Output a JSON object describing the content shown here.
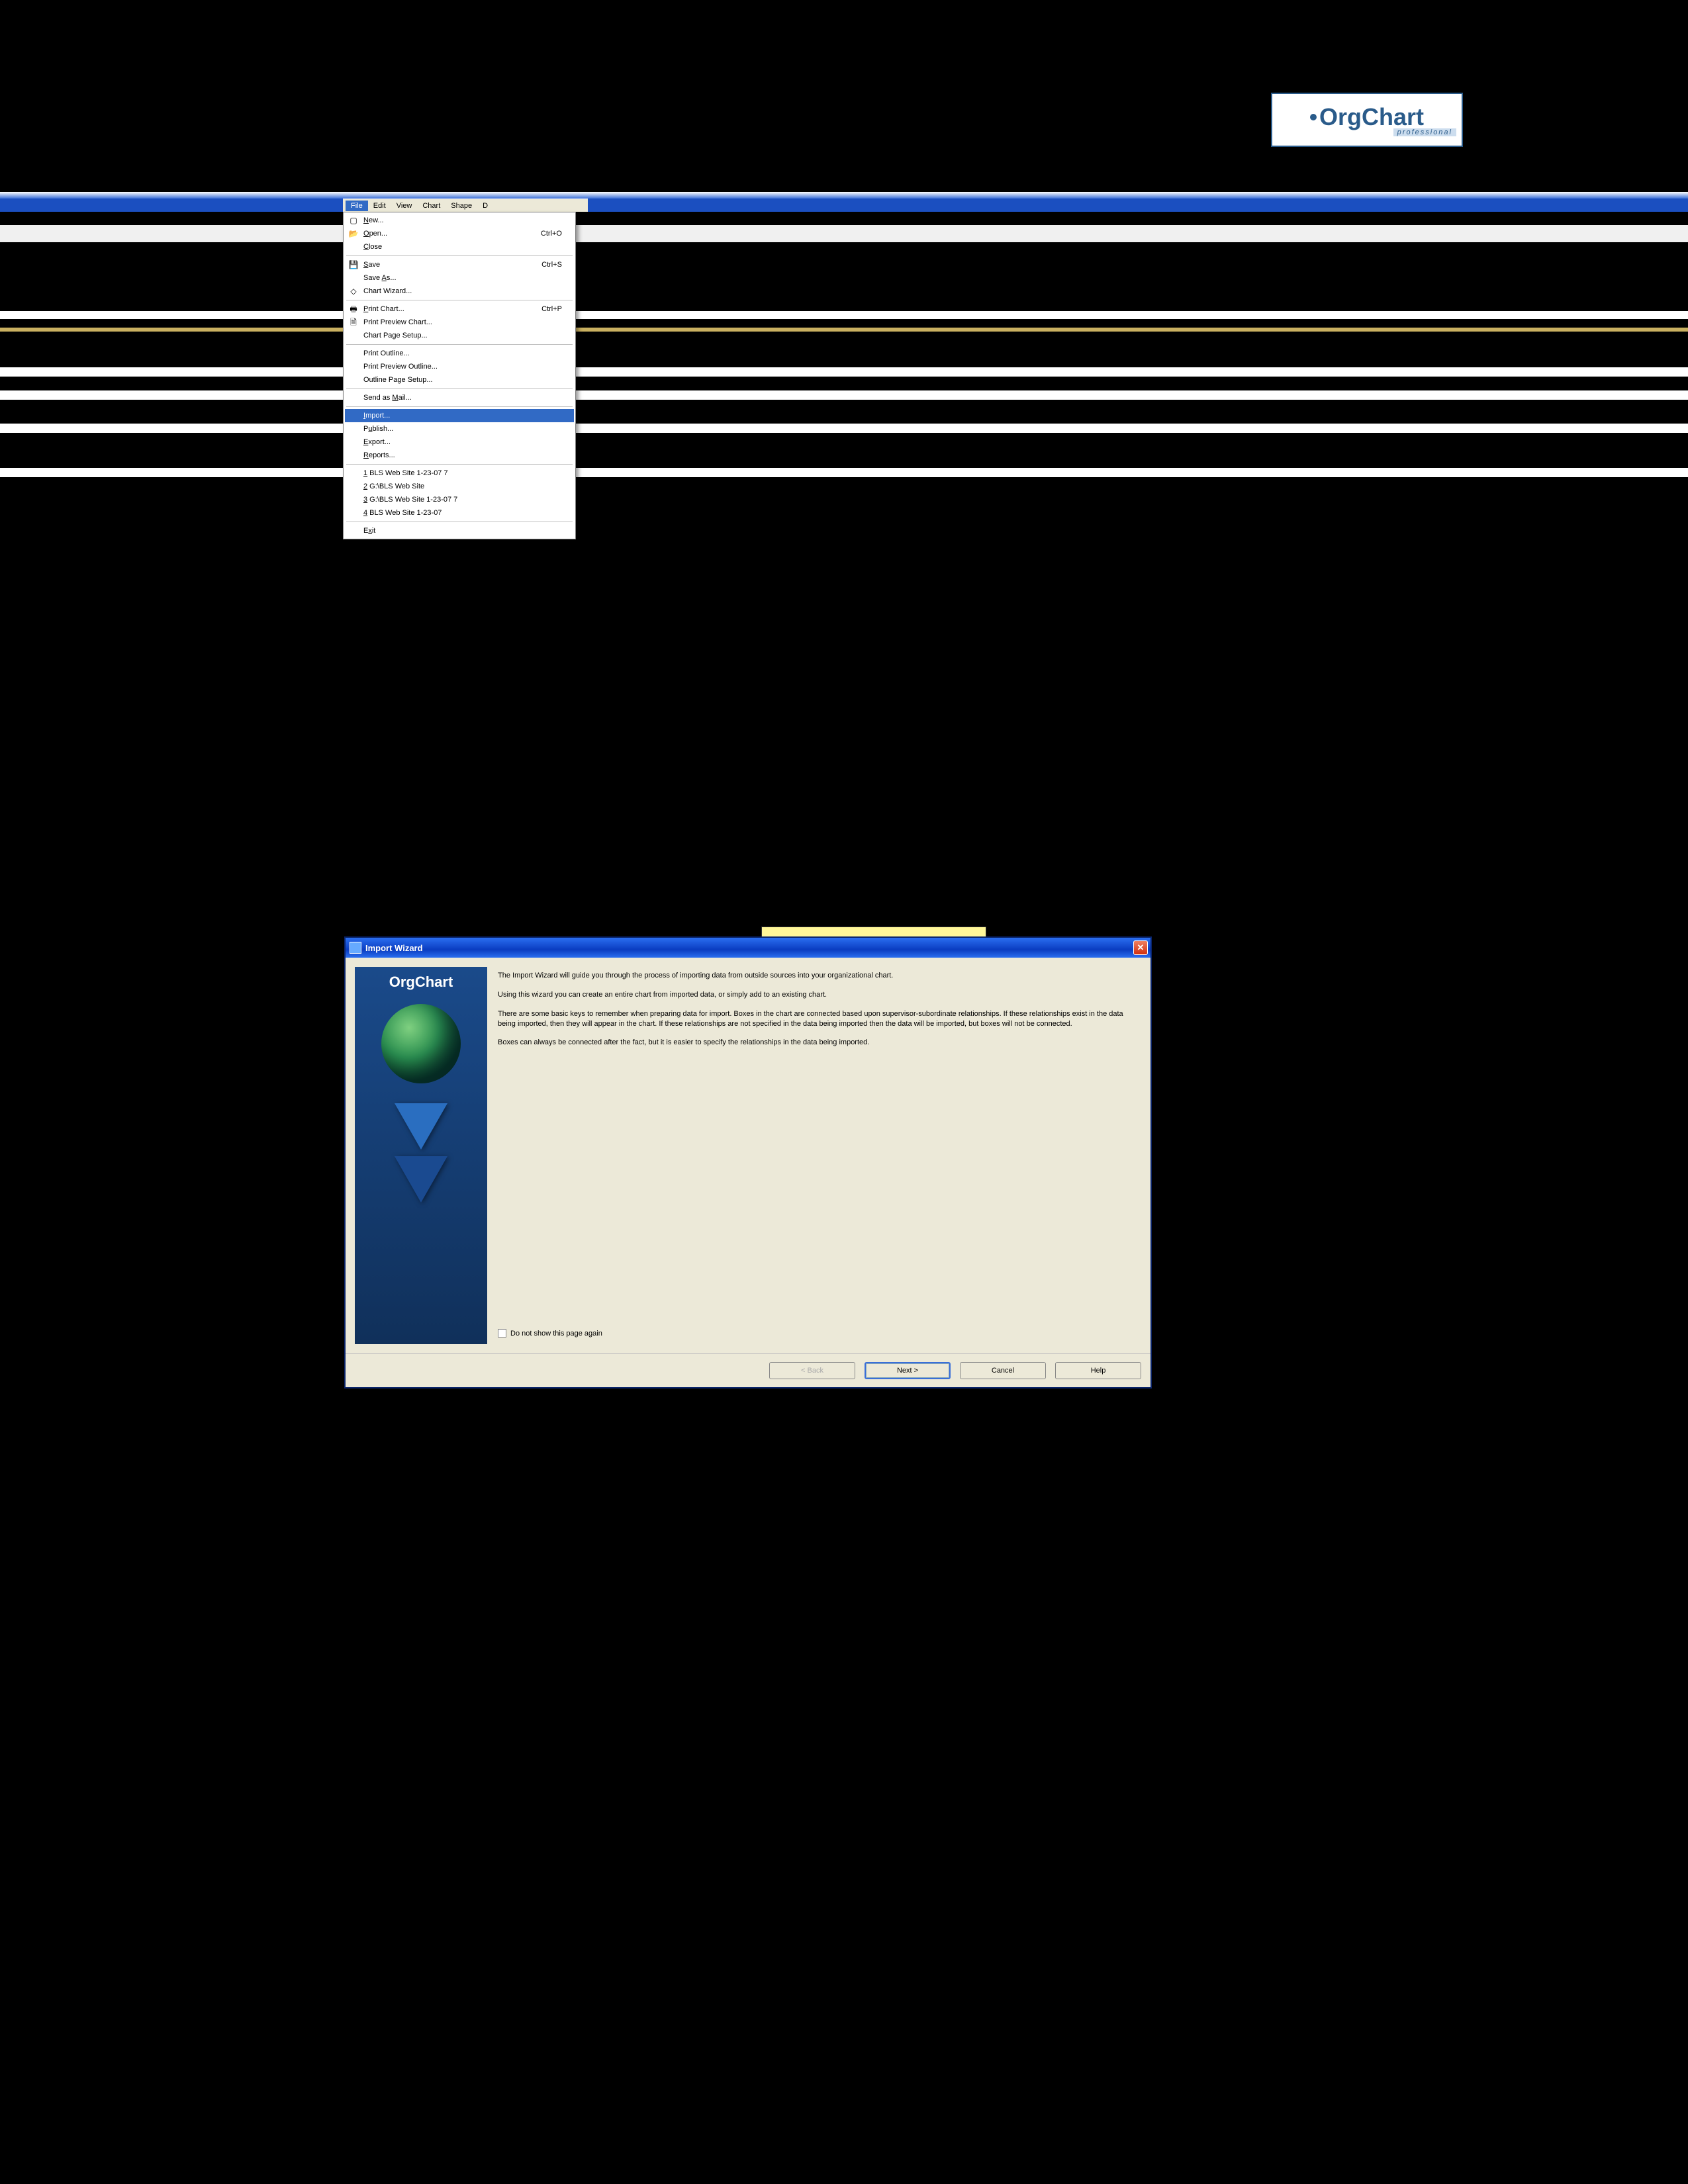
{
  "logo": {
    "text": "OrgChart",
    "subtitle": "professional"
  },
  "menubar": {
    "items": [
      "File",
      "Edit",
      "View",
      "Chart",
      "Shape",
      "D"
    ],
    "active_index": 0
  },
  "file_menu": {
    "groups": [
      [
        {
          "icon": "new-icon",
          "label": "New...",
          "underline": "N",
          "shortcut": ""
        },
        {
          "icon": "open-icon",
          "label": "Open...",
          "underline": "O",
          "shortcut": "Ctrl+O"
        },
        {
          "icon": "",
          "label": "Close",
          "underline": "C",
          "shortcut": ""
        }
      ],
      [
        {
          "icon": "save-icon",
          "label": "Save",
          "underline": "S",
          "shortcut": "Ctrl+S"
        },
        {
          "icon": "",
          "label": "Save As...",
          "underline": "A",
          "shortcut": ""
        },
        {
          "icon": "wizard-icon",
          "label": "Chart Wizard...",
          "underline": "",
          "shortcut": ""
        }
      ],
      [
        {
          "icon": "print-icon",
          "label": "Print Chart...",
          "underline": "P",
          "shortcut": "Ctrl+P"
        },
        {
          "icon": "preview-icon",
          "label": "Print Preview Chart...",
          "underline": "",
          "shortcut": ""
        },
        {
          "icon": "",
          "label": "Chart Page Setup...",
          "underline": "",
          "shortcut": ""
        }
      ],
      [
        {
          "icon": "",
          "label": "Print Outline...",
          "underline": "",
          "shortcut": ""
        },
        {
          "icon": "",
          "label": "Print Preview Outline...",
          "underline": "",
          "shortcut": ""
        },
        {
          "icon": "",
          "label": "Outline Page Setup...",
          "underline": "",
          "shortcut": ""
        }
      ],
      [
        {
          "icon": "",
          "label": "Send as Mail...",
          "underline": "M",
          "shortcut": ""
        }
      ],
      [
        {
          "icon": "",
          "label": "Import...",
          "underline": "I",
          "shortcut": "",
          "highlight": true
        },
        {
          "icon": "",
          "label": "Publish...",
          "underline": "u",
          "shortcut": ""
        },
        {
          "icon": "",
          "label": "Export...",
          "underline": "E",
          "shortcut": ""
        },
        {
          "icon": "",
          "label": "Reports...",
          "underline": "R",
          "shortcut": ""
        }
      ],
      [
        {
          "icon": "",
          "label": "1 BLS Web Site 1-23-07 7",
          "underline": "1",
          "shortcut": ""
        },
        {
          "icon": "",
          "label": "2 G:\\BLS Web Site",
          "underline": "2",
          "shortcut": ""
        },
        {
          "icon": "",
          "label": "3 G:\\BLS Web Site 1-23-07 7",
          "underline": "3",
          "shortcut": ""
        },
        {
          "icon": "",
          "label": "4 BLS Web Site 1-23-07",
          "underline": "4",
          "shortcut": ""
        }
      ],
      [
        {
          "icon": "",
          "label": "Exit",
          "underline": "x",
          "shortcut": ""
        }
      ]
    ]
  },
  "wizard": {
    "title": "Import Wizard",
    "side_title": "OrgChart",
    "paragraphs": [
      "The Import Wizard will guide you through the process of importing data from outside sources into your organizational chart.",
      "Using this wizard you can create an entire chart from imported data, or simply add to an existing chart.",
      "There are some basic keys to remember when preparing data for import. Boxes in the chart are connected based upon supervisor-subordinate relationships. If these relationships exist in the data being imported, then they will appear in the chart. If these relationships are not specified in the data being imported then the data will be imported, but boxes will not be connected.",
      "Boxes can always be connected after the fact, but it is easier to specify the relationships in the data being imported."
    ],
    "checkbox_label": "Do not show this page again",
    "buttons": {
      "back": "< Back",
      "next": "Next >",
      "cancel": "Cancel",
      "help": "Help"
    }
  }
}
